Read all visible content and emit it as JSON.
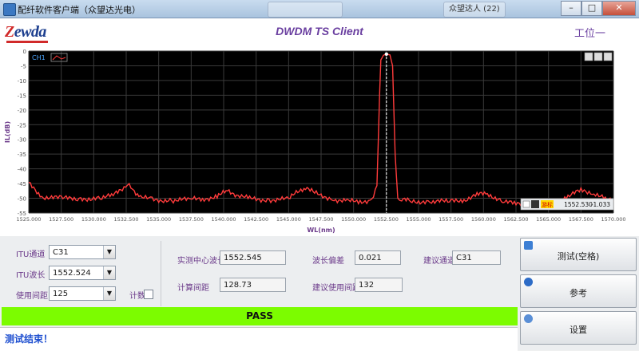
{
  "window": {
    "title": "配纤软件客户端（众望达光电）",
    "bg_tabs": [
      "众望达人 (22)"
    ],
    "controls": {
      "minimize": "–",
      "maximize": "□",
      "close": "✕"
    }
  },
  "header": {
    "logo_first": "Z",
    "logo_rest": "ewda",
    "app_title": "DWDM TS Client",
    "station": "工位一"
  },
  "chart": {
    "channel": "CH1",
    "marker": {
      "label": "游标",
      "x_text": "1552.530",
      "y_text": "-1.033"
    },
    "colors": {
      "background": "#000000",
      "trace": "#ff3b3b",
      "grid": "#3a3a3a",
      "marker": "#ffffff",
      "axis_text": "#555555",
      "axis_label": "#6b3a8a"
    }
  },
  "chart_data": {
    "type": "line",
    "title": "",
    "xlabel": "WL(nm)",
    "ylabel": "IL(dB)",
    "xlim": [
      1525,
      1570
    ],
    "ylim": [
      -55,
      0
    ],
    "x_ticks": [
      "1525.000",
      "1527.500",
      "1530.000",
      "1532.500",
      "1535.000",
      "1537.500",
      "1540.000",
      "1542.500",
      "1545.000",
      "1547.500",
      "1550.000",
      "1552.500",
      "1555.000",
      "1557.500",
      "1560.000",
      "1562.500",
      "1565.000",
      "1567.500",
      "1570.000"
    ],
    "y_ticks": [
      "0",
      "-5",
      "-10",
      "-15",
      "-20",
      "-25",
      "-30",
      "-35",
      "-40",
      "-45",
      "-50",
      "-55"
    ],
    "grid": true,
    "series": [
      {
        "x": [
          1525.0,
          1526.0,
          1527.5,
          1529.0,
          1530.5,
          1531.5,
          1532.2,
          1532.6,
          1533.0,
          1533.6,
          1534.5,
          1536.0,
          1537.5,
          1538.5,
          1539.5,
          1540.3,
          1541.0,
          1542.0,
          1543.5,
          1545.0,
          1545.7,
          1546.3,
          1547.0,
          1548.5,
          1549.5,
          1550.5,
          1551.4,
          1551.8,
          1552.0,
          1552.1,
          1552.3,
          1552.53,
          1552.8,
          1553.0,
          1553.2,
          1553.4,
          1553.7,
          1554.5,
          1556.0,
          1557.5,
          1558.5,
          1559.5,
          1560.3,
          1561.5,
          1562.5,
          1563.5,
          1564.5,
          1565.5,
          1566.5,
          1567.5,
          1568.5,
          1569.5,
          1570.0
        ],
        "y": [
          -45,
          -49.5,
          -50,
          -50.2,
          -50,
          -49,
          -46.5,
          -45.5,
          -47,
          -49.5,
          -50.5,
          -50.7,
          -50.4,
          -50.2,
          -49.4,
          -47.5,
          -48.8,
          -50.2,
          -50.5,
          -50.3,
          -47.8,
          -46.2,
          -48.2,
          -50.4,
          -51,
          -51.2,
          -50.5,
          -46,
          -15,
          -3,
          -1.4,
          -1.033,
          -1.3,
          -5,
          -35,
          -49.5,
          -50.5,
          -51,
          -51.2,
          -51,
          -50.6,
          -48.8,
          -48.5,
          -51,
          -52,
          -51.8,
          -51.5,
          -51.2,
          -49.5,
          -47.2,
          -48.2,
          -50.5,
          -51
        ]
      }
    ]
  },
  "controls": {
    "itu_channel_label": "ITU通道",
    "itu_channel_value": "C31",
    "itu_wavelength_label": "ITU波长",
    "itu_wavelength_value": "1552.524",
    "spacing_label": "使用间距",
    "spacing_value": "125",
    "count_label": "计数",
    "measured_center_label": "实测中心波长",
    "measured_center_value": "1552.545",
    "wl_offset_label": "波长偏差",
    "wl_offset_value": "0.021",
    "suggested_channel_label": "建议通道",
    "suggested_channel_value": "C31",
    "calc_spacing_label": "计算间距",
    "calc_spacing_value": "128.73",
    "suggested_spacing_label": "建议使用间距",
    "suggested_spacing_value": "132"
  },
  "buttons": {
    "test": "测试(空格)",
    "reference": "参考",
    "settings": "设置"
  },
  "result": "PASS",
  "status": "测试结束！"
}
